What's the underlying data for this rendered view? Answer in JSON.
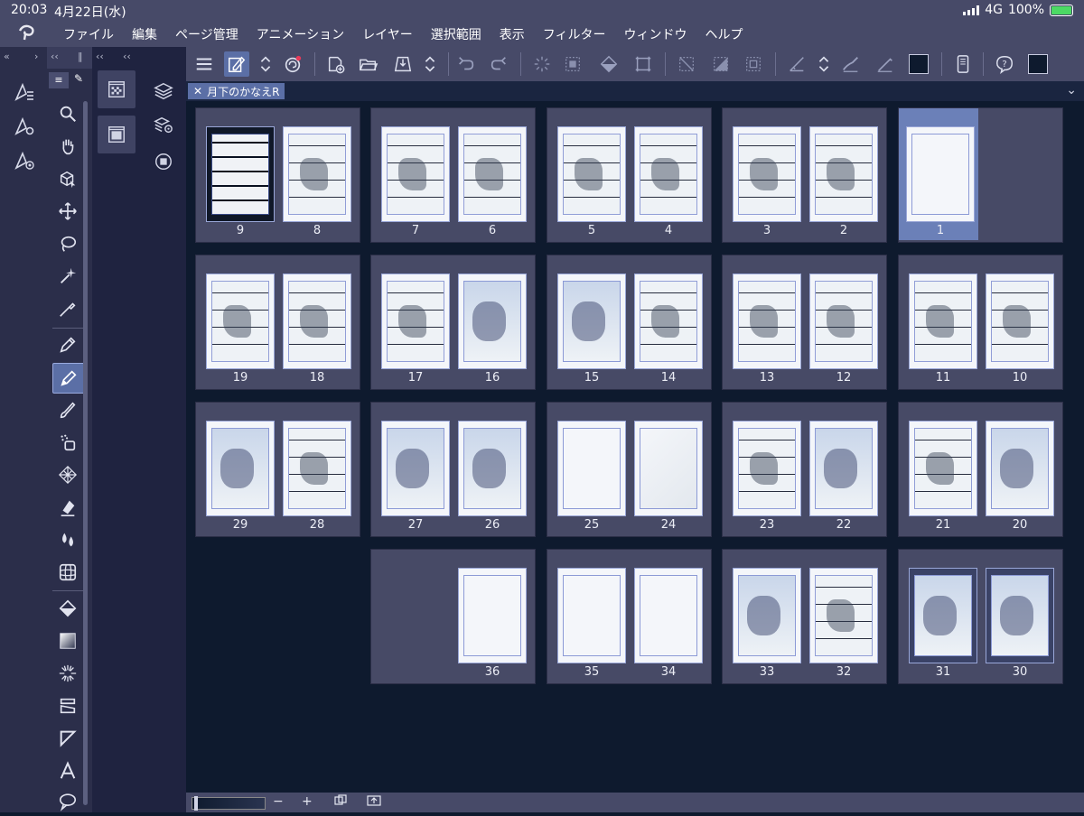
{
  "status": {
    "time": "20:03",
    "date": "4月22日(水)",
    "network": "4G",
    "battery": "100%"
  },
  "menu": [
    "ファイル",
    "編集",
    "ページ管理",
    "アニメーション",
    "レイヤー",
    "選択範囲",
    "表示",
    "フィルター",
    "ウィンドウ",
    "ヘルプ"
  ],
  "document": {
    "tab_title": "月下のかなえR"
  },
  "spreads": [
    {
      "pages": [
        "9",
        "8"
      ]
    },
    {
      "pages": [
        "7",
        "6"
      ]
    },
    {
      "pages": [
        "5",
        "4"
      ]
    },
    {
      "pages": [
        "3",
        "2"
      ]
    },
    {
      "pages": [
        "1"
      ]
    },
    {
      "pages": [
        "19",
        "18"
      ]
    },
    {
      "pages": [
        "17",
        "16"
      ]
    },
    {
      "pages": [
        "15",
        "14"
      ]
    },
    {
      "pages": [
        "13",
        "12"
      ]
    },
    {
      "pages": [
        "11",
        "10"
      ]
    },
    {
      "pages": [
        "29",
        "28"
      ]
    },
    {
      "pages": [
        "27",
        "26"
      ]
    },
    {
      "pages": [
        "25",
        "24"
      ]
    },
    {
      "pages": [
        "23",
        "22"
      ]
    },
    {
      "pages": [
        "21",
        "20"
      ]
    },
    {
      "pages": [
        "36"
      ]
    },
    {
      "pages": [
        "35",
        "34"
      ]
    },
    {
      "pages": [
        "33",
        "32"
      ]
    },
    {
      "pages": [
        "31",
        "30"
      ]
    }
  ],
  "bottombar": {
    "zoom_out": "−",
    "zoom_in": "+"
  },
  "colors": {
    "accent": "#5b6fa6",
    "toolbar": "#474a68",
    "canvas": "#0e1a2e"
  }
}
